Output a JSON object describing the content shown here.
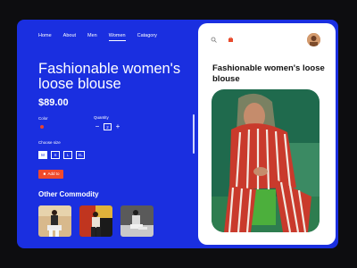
{
  "nav": {
    "items": [
      "Home",
      "About",
      "Men",
      "Women",
      "Catagory"
    ],
    "active": "Women"
  },
  "product": {
    "title": "Fashionable women's loose blouse",
    "price": "$89.00",
    "color_label": "Color",
    "quantity_label": "Quantity",
    "quantity_value": "2",
    "size_label": "Choose size",
    "sizes": [
      "M",
      "S",
      "L",
      "XL"
    ],
    "selected_size": "M",
    "add_label": "Add to"
  },
  "other": {
    "heading": "Other Commodity"
  },
  "card": {
    "title": "Fashionable women's loose blouse"
  },
  "colors": {
    "panel": "#1a2fe0",
    "accent": "#f04a2c",
    "card": "#ffffff"
  },
  "icons": [
    "search-icon",
    "cart-icon",
    "avatar",
    "plus-icon",
    "minus-icon"
  ]
}
